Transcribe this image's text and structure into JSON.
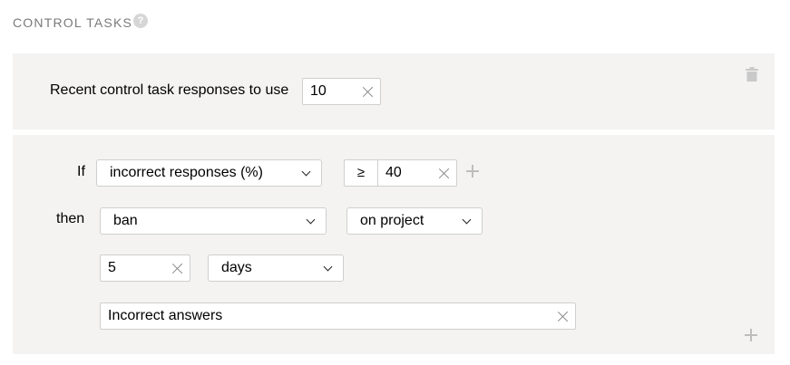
{
  "section": {
    "title": "CONTROL TASKS",
    "help_icon": "?"
  },
  "settings": {
    "recent_label": "Recent control task responses to use",
    "recent_value": "10",
    "delete_icon": "trash-icon"
  },
  "rule": {
    "if_label": "If",
    "condition": "incorrect responses (%)",
    "operator": "≥",
    "threshold": "40",
    "then_label": "then",
    "action": "ban",
    "scope": "on project",
    "duration_value": "5",
    "duration_unit": "days",
    "reason": "Incorrect answers"
  }
}
